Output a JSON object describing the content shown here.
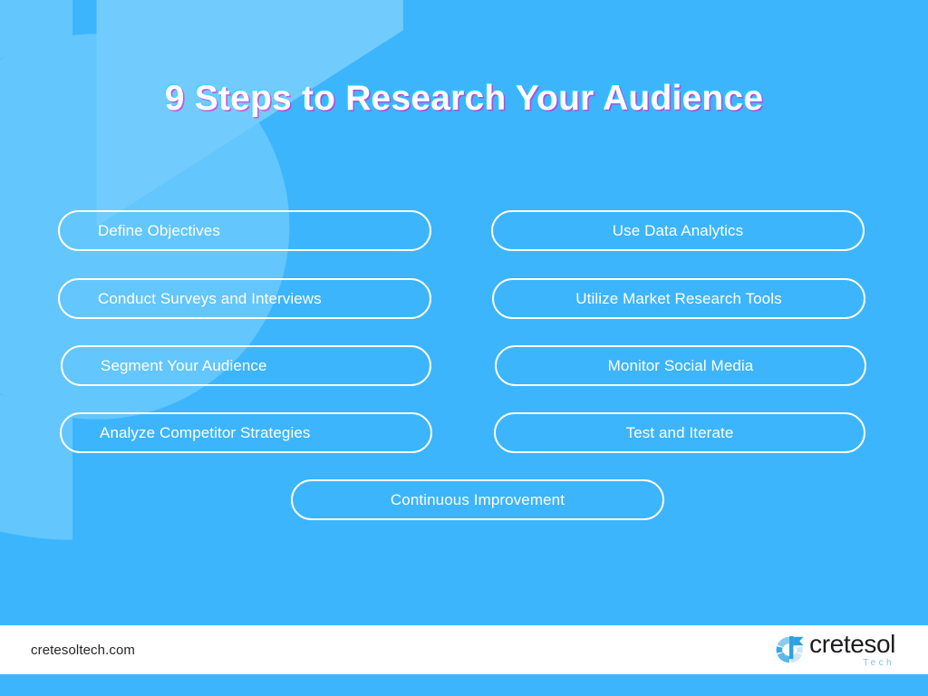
{
  "slide": {
    "background_color": "#3cb5fc",
    "watermark_color": "#63c6fc",
    "title": "9 Steps to Research Your Audience"
  },
  "steps": {
    "left_column": [
      {
        "label": "Define Objectives"
      },
      {
        "label": "Conduct Surveys and Interviews"
      },
      {
        "label": "Segment Your Audience"
      },
      {
        "label": "Analyze Competitor Strategies"
      }
    ],
    "right_column": [
      {
        "label": "Use Data Analytics"
      },
      {
        "label": "Utilize Market Research Tools"
      },
      {
        "label": "Monitor Social Media"
      },
      {
        "label": "Test and Iterate"
      }
    ],
    "bottom": [
      {
        "label": "Continuous Improvement"
      }
    ]
  },
  "footer": {
    "site_url": "cretesoltech.com",
    "logo": {
      "wordmark": "cretesol",
      "tagline": "Tech",
      "mark_colors": {
        "arc_light": "#cfe6f5",
        "arc_mid": "#8ccbec",
        "arc_dark": "#3aa9e0",
        "flag": "#2da2de"
      },
      "wordmark_color": "#1d1d1f",
      "tagline_color": "#7fc4e8"
    }
  }
}
